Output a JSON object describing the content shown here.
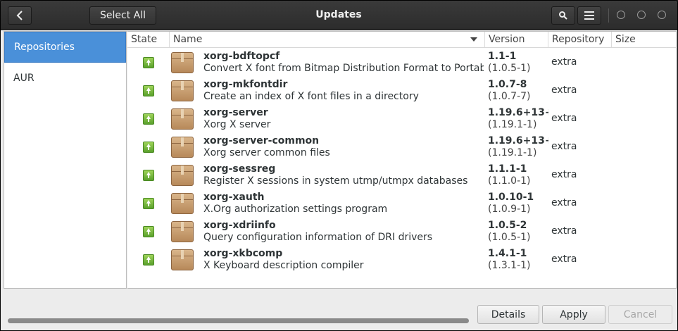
{
  "window": {
    "title": "Updates"
  },
  "header": {
    "select_all_label": "Select All",
    "back_icon": "chevron-left-icon",
    "search_icon": "search-icon",
    "menu_icon": "hamburger-menu-icon"
  },
  "sidebar": {
    "items": [
      {
        "label": "Repositories",
        "active": true
      },
      {
        "label": "AUR",
        "active": false
      }
    ]
  },
  "columns": {
    "state": "State",
    "name": "Name",
    "version": "Version",
    "repository": "Repository",
    "size": "Size"
  },
  "packages": [
    {
      "name": "xorg-bdftopcf",
      "description": "Convert X font from Bitmap Distribution Format to Portable C",
      "new_version": "1.1-1",
      "old_version": "(1.0.5-1)",
      "repository": "extra"
    },
    {
      "name": "xorg-mkfontdir",
      "description": "Create an index of X font files in a directory",
      "new_version": "1.0.7-8",
      "old_version": "(1.0.7-7)",
      "repository": "extra"
    },
    {
      "name": "xorg-server",
      "description": "Xorg X server",
      "new_version": "1.19.6+13+",
      "old_version": "(1.19.1-1)",
      "repository": "extra"
    },
    {
      "name": "xorg-server-common",
      "description": "Xorg server common files",
      "new_version": "1.19.6+13+",
      "old_version": "(1.19.1-1)",
      "repository": "extra"
    },
    {
      "name": "xorg-sessreg",
      "description": "Register X sessions in system utmp/utmpx databases",
      "new_version": "1.1.1-1",
      "old_version": "(1.1.0-1)",
      "repository": "extra"
    },
    {
      "name": "xorg-xauth",
      "description": "X.Org authorization settings program",
      "new_version": "1.0.10-1",
      "old_version": "(1.0.9-1)",
      "repository": "extra"
    },
    {
      "name": "xorg-xdriinfo",
      "description": "Query configuration information of DRI drivers",
      "new_version": "1.0.5-2",
      "old_version": "(1.0.5-1)",
      "repository": "extra"
    },
    {
      "name": "xorg-xkbcomp",
      "description": "X Keyboard description compiler",
      "new_version": "1.4.1-1",
      "old_version": "(1.3.1-1)",
      "repository": "extra"
    }
  ],
  "footer": {
    "details_label": "Details",
    "apply_label": "Apply",
    "cancel_label": "Cancel"
  },
  "colors": {
    "accent": "#4a90d9",
    "header_bg": "#2c2c2c",
    "update_icon": "#5aa02c"
  }
}
